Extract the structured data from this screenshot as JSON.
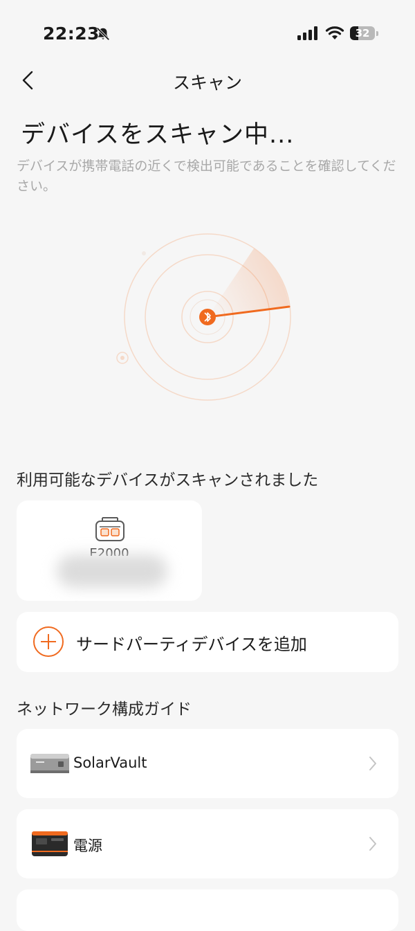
{
  "status_bar": {
    "time": "22:23",
    "battery": "32",
    "battery_level": 0.32
  },
  "nav": {
    "title": "スキャン"
  },
  "heading": "デバイスをスキャン中...",
  "subtitle": "デバイスが携帯電話の近くで検出可能であることを確認してください。",
  "available_section": {
    "title": "利用可能なデバイスがスキャンされました",
    "devices": [
      {
        "name": "E2000"
      }
    ]
  },
  "add_third_party": {
    "label": "サードパーティデバイスを追加"
  },
  "guide_section": {
    "title": "ネットワーク構成ガイド",
    "items": [
      {
        "label": "SolarVault"
      },
      {
        "label": "電源"
      }
    ]
  },
  "colors": {
    "accent": "#f06a1f",
    "background": "#f6f6f6",
    "card": "#ffffff",
    "muted_text": "#a8a8a8"
  },
  "icons": {
    "back": "chevron-left-icon",
    "bell": "bell-slash-icon",
    "bluetooth": "bluetooth-icon",
    "add": "plus-circle-icon",
    "chevron": "chevron-right-icon",
    "device": "power-station-icon"
  }
}
